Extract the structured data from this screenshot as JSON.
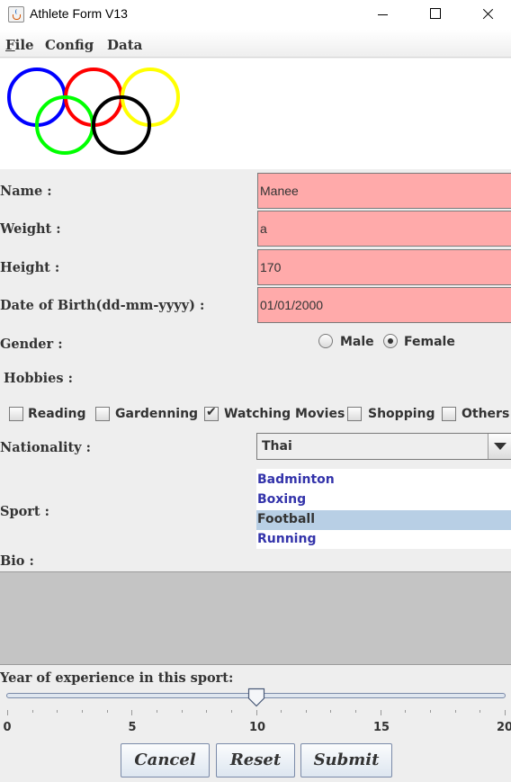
{
  "window": {
    "title": "Athlete Form V13",
    "icon": "java-cup-icon"
  },
  "menu": {
    "items": [
      "File",
      "Config",
      "Data"
    ]
  },
  "logo": {
    "ring_colors": [
      "#0000ff",
      "#ff0000",
      "#ffff00",
      "#00ff00",
      "#000000"
    ]
  },
  "form": {
    "name": {
      "label": "Name :",
      "value": "Manee"
    },
    "weight": {
      "label": "Weight :",
      "value": "a"
    },
    "height": {
      "label": "Height :",
      "value": "170"
    },
    "dob": {
      "label": "Date of Birth(dd-mm-yyyy) :",
      "value": "01/01/2000"
    },
    "field_color": "#ffaaaa",
    "gender": {
      "label": "Gender :",
      "options": [
        "Male",
        "Female"
      ],
      "selected": "Female"
    },
    "hobbies": {
      "label": "Hobbies :",
      "options": [
        {
          "label": "Reading",
          "checked": false
        },
        {
          "label": "Gardenning",
          "checked": false
        },
        {
          "label": "Watching Movies",
          "checked": true
        },
        {
          "label": "Shopping",
          "checked": false
        },
        {
          "label": "Others",
          "checked": false
        }
      ]
    },
    "nationality": {
      "label": "Nationality :",
      "value": "Thai"
    },
    "sport": {
      "label": "Sport :",
      "options": [
        "Badminton",
        "Boxing",
        "Football",
        "Running"
      ],
      "selected": "Football"
    },
    "bio": {
      "label": "Bio :",
      "value": ""
    },
    "experience": {
      "label": "Year of experience in this sport:",
      "min": 0,
      "max": 20,
      "value": 10,
      "tick_labels": [
        "0",
        "5",
        "10",
        "15",
        "20"
      ]
    }
  },
  "buttons": {
    "cancel": "Cancel",
    "reset": "Reset",
    "submit": "Submit"
  }
}
